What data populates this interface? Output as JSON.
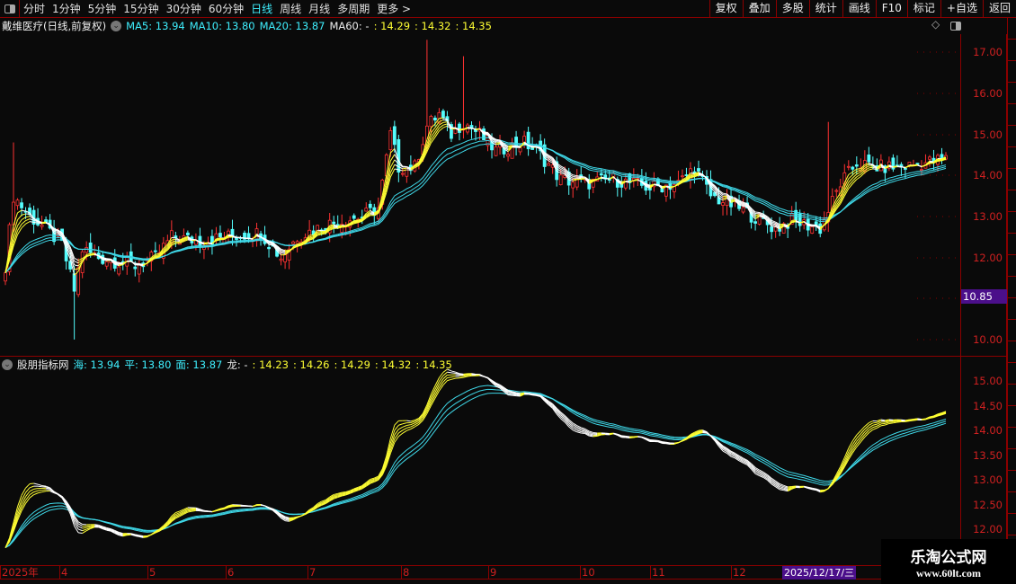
{
  "toolbar": {
    "periods": [
      "分时",
      "1分钟",
      "5分钟",
      "15分钟",
      "30分钟",
      "60分钟",
      "日线",
      "周线",
      "月线",
      "多周期",
      "更多 >"
    ],
    "active_period": "日线",
    "actions": [
      "复权",
      "叠加",
      "多股",
      "统计",
      "画线",
      "F10",
      "标记",
      "+自选",
      "返回"
    ]
  },
  "main": {
    "title": "戴维医疗(日线,前复权)",
    "ma5": "MA5: 13.94",
    "ma10": "MA10: 13.80",
    "ma20": "MA20: 13.87",
    "ma60": "MA60: -",
    "ma_extra": [
      ": 14.29",
      ": 14.32",
      ": 14.35"
    ],
    "y_ticks": [
      "17.00",
      "16.00",
      "15.00",
      "14.00",
      "13.00",
      "12.00",
      "10.00"
    ],
    "price_tag": "10.85",
    "diamond_icon": "◇"
  },
  "indicator": {
    "title": "股朋指标网",
    "hai": "海: 13.94",
    "ping": "平: 13.80",
    "mian": "面: 13.87",
    "long": "龙: -",
    "long_extra": [
      ": 14.23",
      ": 14.26",
      ": 14.29",
      ": 14.32",
      ": 14.35"
    ],
    "y_ticks": [
      "15.00",
      "14.50",
      "14.00",
      "13.50",
      "13.00",
      "12.50",
      "12.00"
    ]
  },
  "date_axis": {
    "labels": [
      "2025年",
      "4",
      "5",
      "6",
      "7",
      "8",
      "9",
      "10",
      "11",
      "12"
    ],
    "cursor_date": "2025/12/17/三"
  },
  "watermark": {
    "name": "乐淘公式网",
    "url": "www.60lt.com"
  },
  "colors": {
    "up": "#ff3232",
    "down": "#54fcfc",
    "fast_rise": "#ffff33",
    "fast_fall": "#ffffff",
    "slow": "#3fd8e8",
    "grid_red": "#8b0000"
  },
  "chart_data": {
    "type": "candlestick",
    "bars": 233,
    "upper_ylim": [
      9.6,
      17.4
    ],
    "lower_ylim": [
      11.8,
      15.3
    ],
    "close_path": [
      [
        0,
        11.8
      ],
      [
        2,
        13.5
      ],
      [
        6,
        13.0
      ],
      [
        10,
        12.7
      ],
      [
        14,
        12.3
      ],
      [
        17,
        11.2
      ],
      [
        19,
        12.2
      ],
      [
        23,
        12.0
      ],
      [
        32,
        11.8
      ],
      [
        37,
        12.0
      ],
      [
        41,
        12.5
      ],
      [
        48,
        12.4
      ],
      [
        54,
        12.5
      ],
      [
        63,
        12.6
      ],
      [
        68,
        12.0
      ],
      [
        72,
        12.5
      ],
      [
        79,
        12.8
      ],
      [
        88,
        13.0
      ],
      [
        92,
        13.2
      ],
      [
        95,
        15.0
      ],
      [
        97,
        14.2
      ],
      [
        101,
        14.2
      ],
      [
        104,
        15.2
      ],
      [
        107,
        15.5
      ],
      [
        110,
        15.0
      ],
      [
        113,
        15.3
      ],
      [
        117,
        15.0
      ],
      [
        121,
        14.6
      ],
      [
        128,
        14.8
      ],
      [
        132,
        14.5
      ],
      [
        137,
        13.9
      ],
      [
        143,
        13.8
      ],
      [
        150,
        13.9
      ],
      [
        159,
        13.7
      ],
      [
        166,
        13.8
      ],
      [
        170,
        14.2
      ],
      [
        174,
        13.5
      ],
      [
        181,
        13.2
      ],
      [
        190,
        12.7
      ],
      [
        194,
        12.9
      ],
      [
        201,
        12.7
      ],
      [
        206,
        13.8
      ],
      [
        210,
        14.3
      ],
      [
        214,
        14.2
      ],
      [
        221,
        14.2
      ],
      [
        232,
        14.4
      ]
    ],
    "spikes": [
      [
        2,
        14.8
      ],
      [
        17,
        10.0
      ],
      [
        104,
        17.3
      ],
      [
        113,
        16.9
      ],
      [
        203,
        15.3
      ]
    ],
    "fast_periods": [
      3,
      4,
      5,
      6,
      7
    ],
    "slow_periods": [
      18,
      21,
      24
    ]
  }
}
